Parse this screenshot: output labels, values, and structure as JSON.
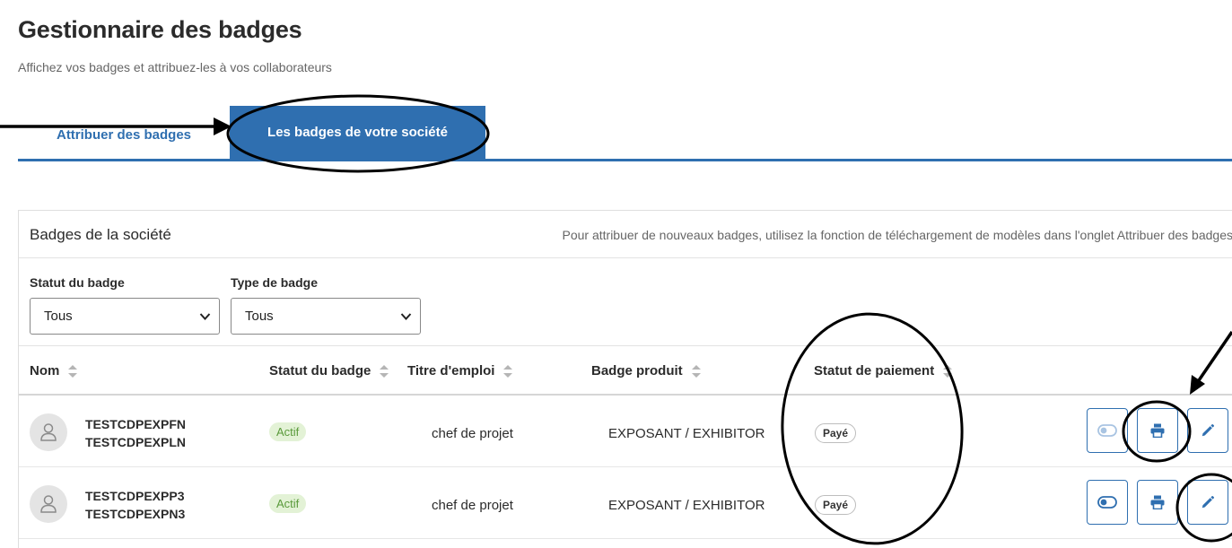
{
  "header": {
    "title": "Gestionnaire des badges",
    "subtitle": "Affichez vos badges et attribuez-les à vos collaborateurs"
  },
  "tabs": [
    {
      "label": "Attribuer des badges",
      "active": false
    },
    {
      "label": "Les badges de votre société",
      "active": true
    }
  ],
  "card": {
    "title": "Badges de la société",
    "hint": "Pour attribuer de nouveaux badges, utilisez la fonction de téléchargement de modèles dans l'onglet Attribuer des badges"
  },
  "filters": {
    "status": {
      "label": "Statut du badge",
      "value": "Tous"
    },
    "type": {
      "label": "Type de badge",
      "value": "Tous"
    }
  },
  "table": {
    "columns": [
      "Nom",
      "Statut du badge",
      "Titre d'emploi",
      "Badge produit",
      "Statut de paiement"
    ],
    "rows": [
      {
        "first_name": "TESTCDPEXPFN",
        "last_name": "TESTCDPEXPLN",
        "status": "Actif",
        "job_title": "chef de projet",
        "product": "EXPOSANT / EXHIBITOR",
        "payment": "Payé"
      },
      {
        "first_name": "TESTCDPEXPP3",
        "last_name": "TESTCDPEXPN3",
        "status": "Actif",
        "job_title": "chef de projet",
        "product": "EXPOSANT / EXHIBITOR",
        "payment": "Payé"
      }
    ]
  },
  "colors": {
    "primary": "#2f6fb0",
    "active_badge_bg": "#e3f2d6",
    "active_badge_text": "#5a9a3b"
  },
  "icons": [
    "user-icon",
    "toggle-icon",
    "printer-icon",
    "pencil-icon",
    "chevron-down-icon",
    "sort-icon"
  ]
}
